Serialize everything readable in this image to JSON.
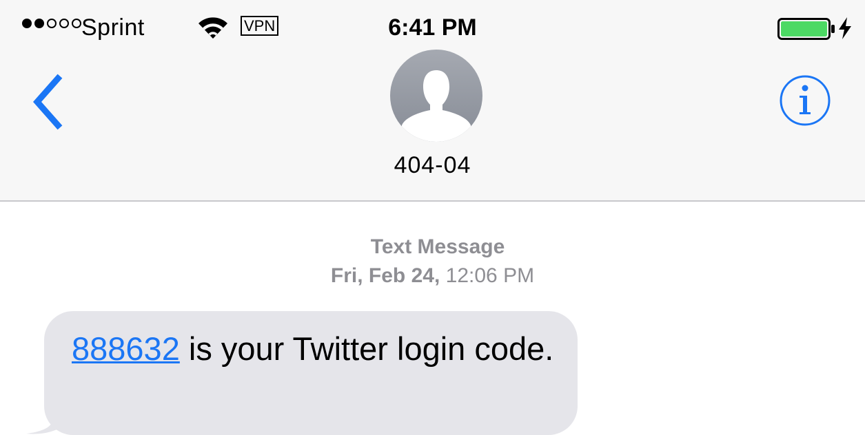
{
  "status_bar": {
    "signal_filled": 2,
    "signal_total": 5,
    "carrier": "Sprint",
    "vpn": "VPN",
    "time": "6:41 PM",
    "battery_icon": "battery-full-icon",
    "charging_icon": "charging-bolt-icon"
  },
  "nav": {
    "back_icon": "chevron-left-icon",
    "info_icon": "info-icon",
    "contact_name": "404-04",
    "accent_color": "#1b76f5"
  },
  "message_header": {
    "type": "Text Message",
    "day": "Fri, Feb 24,",
    "time": "12:06 PM"
  },
  "messages": [
    {
      "direction": "incoming",
      "code": "888632",
      "text": " is your Twitter login code."
    }
  ]
}
